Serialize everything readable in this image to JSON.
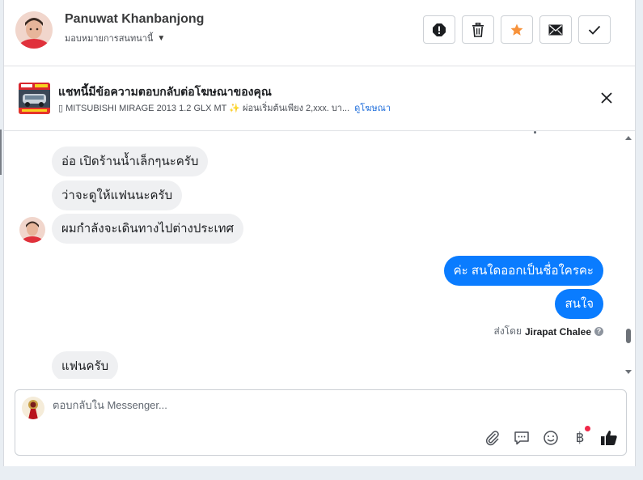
{
  "header": {
    "contact_name": "Panuwat Khanbanjong",
    "assign_label": "มอบหมายการสนทนานี้",
    "actions": [
      {
        "icon": "alert-icon",
        "name": "mark-spam-button"
      },
      {
        "icon": "trash-icon",
        "name": "delete-button"
      },
      {
        "icon": "star-icon",
        "name": "star-button",
        "color": "#f7923b"
      },
      {
        "icon": "envelope-icon",
        "name": "mark-unread-button"
      },
      {
        "icon": "check-icon",
        "name": "mark-done-button"
      }
    ]
  },
  "ad_bar": {
    "title": "แชทนี้มีข้อความตอบกลับต่อโฆษณาของคุณ",
    "subtitle": "▯ MITSUBISHI MIRAGE 2013 1.2 GLX MT ✨ ผ่อนเริ่มต้นเพียง 2,xxx. บา...",
    "link": "ดูโฆษณา"
  },
  "messages": {
    "in_1": "อ่อ เปิดร้านน้ำเล็กๆนะครับ",
    "in_2": "ว่าจะดูให้แฟนนะครับ",
    "in_3": "ผมกำลังจะเดินทางไปต่างประเทศ",
    "out_1": "ค่ะ สนใดออกเป็นชื่อใครคะ",
    "out_2": "สนใจ",
    "sent_by_prefix": "ส่งโดย",
    "sent_by_name": "Jirapat Chalee",
    "in_4": "แฟนครับ"
  },
  "composer": {
    "placeholder": "ตอบกลับใน Messenger..."
  },
  "colors": {
    "outgoing_bubble": "#0a7cff",
    "incoming_bubble": "#eff0f2",
    "accent_star": "#f7923b",
    "notification_dot": "#f02849"
  }
}
